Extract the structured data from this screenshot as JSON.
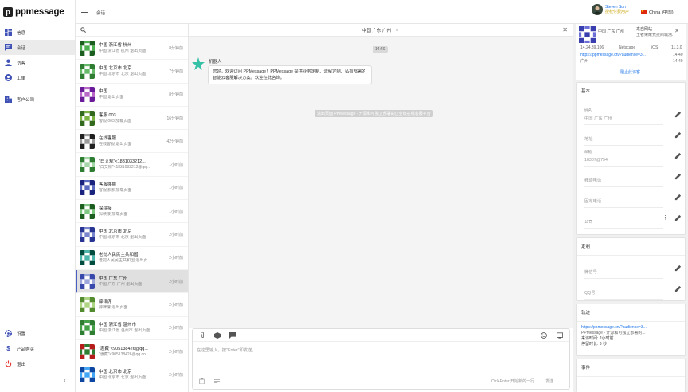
{
  "app": {
    "logo": "ppmessage"
  },
  "nav": {
    "items": [
      {
        "label": "信息",
        "icon": "dashboard-icon"
      },
      {
        "label": "会话",
        "icon": "chat-icon"
      },
      {
        "label": "访客",
        "icon": "visitor-icon"
      },
      {
        "label": "工单",
        "icon": "ticket-icon"
      },
      {
        "label": "客户公司",
        "icon": "company-icon"
      }
    ],
    "bottom": [
      {
        "label": "设置",
        "icon": "gear-icon"
      },
      {
        "label": "产品购买",
        "icon": "dollar-icon"
      },
      {
        "label": "退出",
        "icon": "power-icon"
      }
    ]
  },
  "topbar": {
    "title": "会话",
    "user_name": "Steven Sun",
    "user_role": "授权付费用户",
    "language": "China (中国)"
  },
  "sessions": [
    {
      "name": "中国 浙江省 杭州",
      "sub": "中国 浙江省 杭州 退出页面",
      "time": "8分钟前"
    },
    {
      "name": "中国 北京市 北京",
      "sub": "中国 北京市 北京 退出页面",
      "time": "7分钟前"
    },
    {
      "name": "中国",
      "sub": "中国 退出页面",
      "time": "8分钟前"
    },
    {
      "name": "客服 003",
      "sub": "客服 003 加载页面",
      "time": "16分钟前"
    },
    {
      "name": "在线客服",
      "sub": "在线客服 退出页面",
      "time": "42分钟前"
    },
    {
      "name": "\"白艾规\"<1831033212...",
      "sub": "\"白艾规\"<1831033212@qq...",
      "time": "1小时前"
    },
    {
      "name": "客服挪挪",
      "sub": "客服挪挪 加载页面",
      "time": "1小时前"
    },
    {
      "name": "探续接",
      "sub": "探续接 加载页面",
      "time": "1小时前"
    },
    {
      "name": "中国 北京市 北京",
      "sub": "中国 北京市 北京 退出页面",
      "time": "2小时前"
    },
    {
      "name": "老挝人民民主共和国",
      "sub": "老挝人民民主共和国 退出页",
      "time": "2小时前"
    },
    {
      "name": "中国 广东 广州",
      "sub": "中国 广东 广州 退出页面",
      "time": "2小时前"
    },
    {
      "name": "薛律席",
      "sub": "薛律席 退出页面",
      "time": "2小时前"
    },
    {
      "name": "中国 浙江省 温州市",
      "sub": "中国 浙江省 温州市 退出页面",
      "time": "2小时前"
    },
    {
      "name": "\"惠藏\"<905138426@qq...",
      "sub": "\"惠藏\"<905138426@qq.co...",
      "time": "2小时前"
    },
    {
      "name": "中国 北京市 北京",
      "sub": "中国 北京市 北京 退出页面",
      "time": "2小时前"
    }
  ],
  "chat": {
    "title": "中国 广东 广州",
    "time_chip": "14:40",
    "robot_name": "机器人",
    "message": "您好，欢迎访问 PPMessage！PPMessage 提供业务定制、流程定制、私有部署的智能云客服解决方案。欢迎在此咨询。",
    "system_notice": "退出页面 PPMessage - 开源和可独立部署的企业级在线客服平台",
    "input_placeholder": "在这里输入，按\"Enter\"即发送。",
    "hint": "Ctrl+Enter 开始新的一行",
    "send": "发送"
  },
  "panel": {
    "visitor_name": "中国 广东 广州",
    "visit_source": "来自网站",
    "visit_source_sub": "王者荣耀竞技商城测...",
    "ip": "14.24.39.106",
    "browser": "Netscape",
    "os": "iOS",
    "os_version": "11.3.0",
    "url": "https://ppmessage.cn/?audience=3...",
    "url_time": "14:40",
    "city": "广州",
    "city_time": "14:40",
    "block_button": "阻止此访客",
    "basic_title": "基本",
    "basic_fields": [
      {
        "label": "姓名",
        "value": "中国 广东 广州"
      },
      {
        "label": "",
        "value": "地址"
      },
      {
        "label": "邮箱",
        "value": "18307@754"
      },
      {
        "label": "",
        "value": "移动电话"
      },
      {
        "label": "",
        "value": "固定电话"
      },
      {
        "label": "",
        "value": "公司"
      }
    ],
    "custom_title": "定制",
    "custom_fields": [
      {
        "label": "",
        "value": "微信号"
      },
      {
        "label": "",
        "value": "QQ号"
      }
    ],
    "track_title": "轨迹",
    "track_url": "https://ppmessage.cn/?audience=3...",
    "track_desc": "PPMessage - 开源和可独立部署的...",
    "track_time": "来访时间: 2小时前",
    "track_duration": "停留时长: 6 秒",
    "event_title": "事件"
  }
}
